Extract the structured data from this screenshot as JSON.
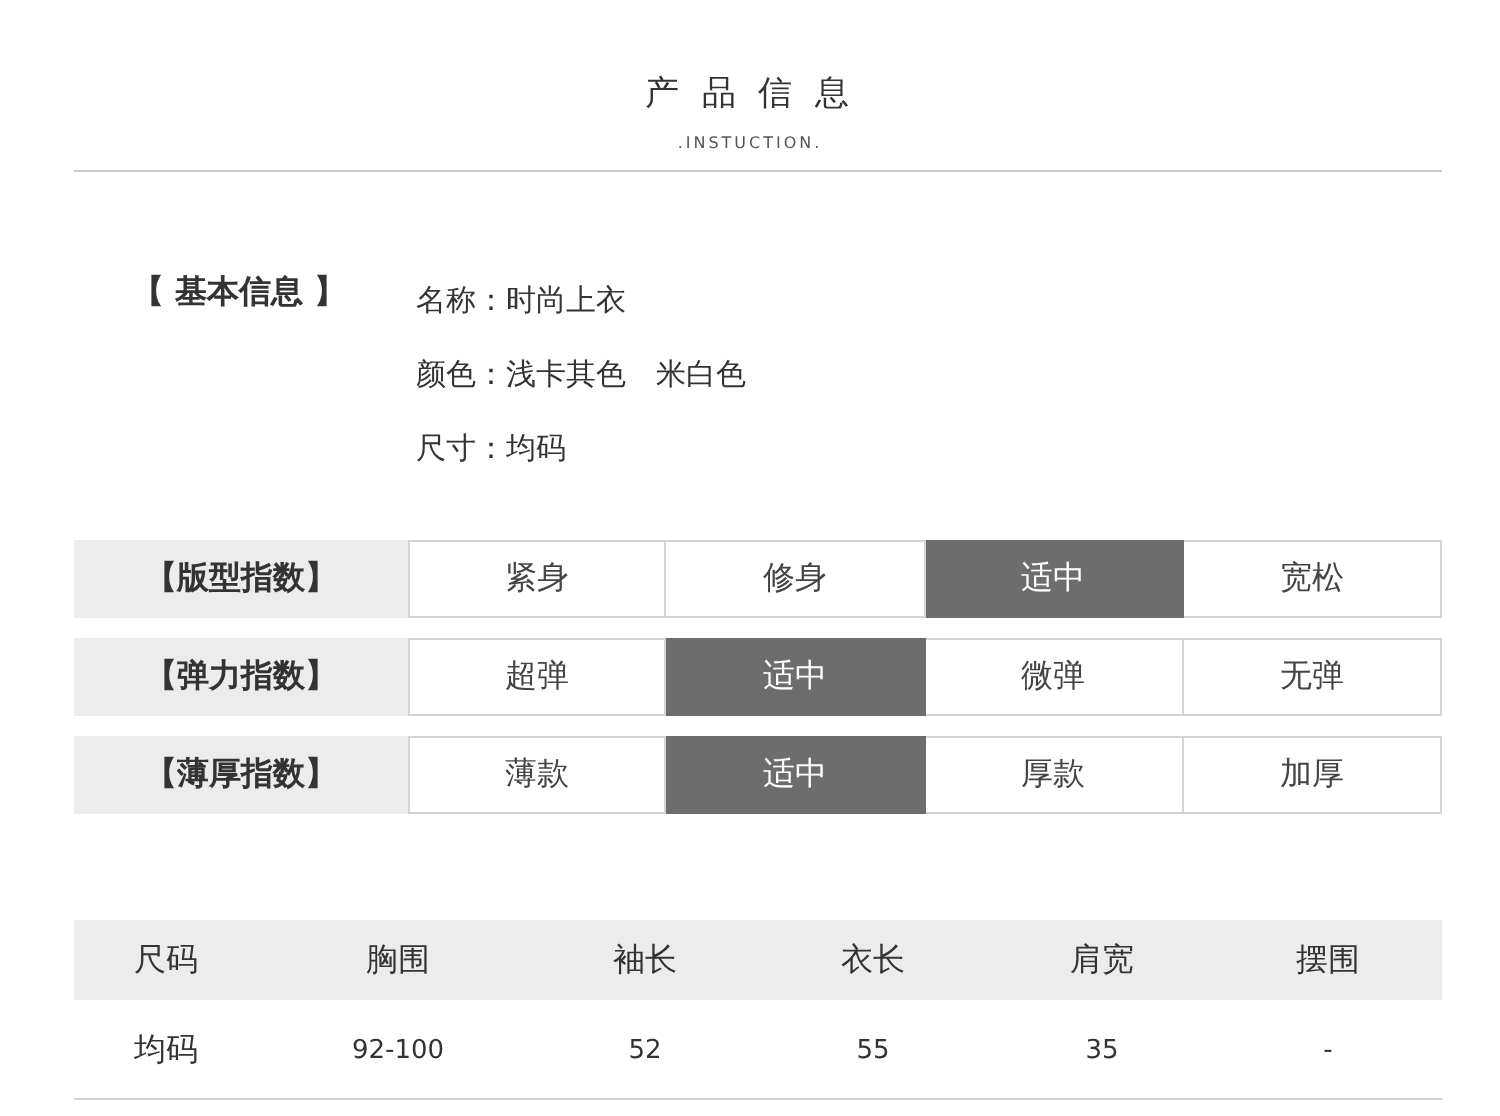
{
  "header": {
    "title": "产 品 信 息",
    "subtitle": ".INSTUCTION."
  },
  "basic_info": {
    "label": "【 基本信息 】",
    "lines": [
      "名称：时尚上衣",
      "颜色：浅卡其色　米白色",
      "尺寸：均码"
    ]
  },
  "indices": [
    {
      "label": "【版型指数】",
      "options": [
        {
          "text": "紧身",
          "selected": false
        },
        {
          "text": "修身",
          "selected": false
        },
        {
          "text": "适中",
          "selected": true
        },
        {
          "text": "宽松",
          "selected": false
        }
      ]
    },
    {
      "label": "【弹力指数】",
      "options": [
        {
          "text": "超弹",
          "selected": false
        },
        {
          "text": "适中",
          "selected": true
        },
        {
          "text": "微弹",
          "selected": false
        },
        {
          "text": "无弹",
          "selected": false
        }
      ]
    },
    {
      "label": "【薄厚指数】",
      "options": [
        {
          "text": "薄款",
          "selected": false
        },
        {
          "text": "适中",
          "selected": true
        },
        {
          "text": "厚款",
          "selected": false
        },
        {
          "text": "加厚",
          "selected": false
        }
      ]
    }
  ],
  "size_table": {
    "columns": [
      "尺码",
      "胸围",
      "袖长",
      "衣长",
      "肩宽",
      "摆围"
    ],
    "rows": [
      [
        "均码",
        "92-100",
        "52",
        "55",
        "35",
        "-"
      ]
    ]
  }
}
